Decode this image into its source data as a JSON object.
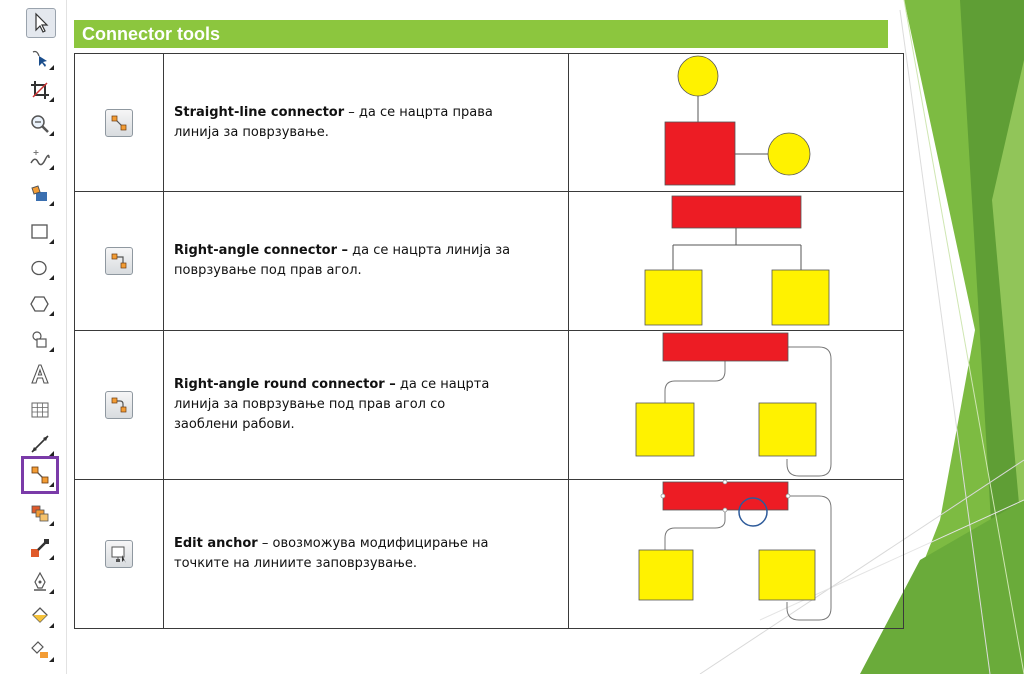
{
  "section_title": "Connector tools",
  "toolbox": {
    "tools": [
      {
        "name": "pick-tool",
        "icon": "arrow-icon"
      },
      {
        "name": "shape-tool",
        "icon": "node-edit-icon"
      },
      {
        "name": "crop-tool",
        "icon": "crop-icon"
      },
      {
        "name": "zoom-tool",
        "icon": "magnifier-icon"
      },
      {
        "name": "freehand-tool",
        "icon": "freehand-icon"
      },
      {
        "name": "smart-fill-tool",
        "icon": "smart-fill-icon"
      },
      {
        "name": "rectangle-tool",
        "icon": "rectangle-icon"
      },
      {
        "name": "ellipse-tool",
        "icon": "ellipse-icon"
      },
      {
        "name": "polygon-tool",
        "icon": "polygon-icon"
      },
      {
        "name": "basic-shapes-tool",
        "icon": "basic-shapes-icon"
      },
      {
        "name": "text-tool",
        "icon": "text-a-icon"
      },
      {
        "name": "table-tool",
        "icon": "table-icon"
      },
      {
        "name": "dimension-tool",
        "icon": "dimension-icon"
      },
      {
        "name": "connector-tool",
        "icon": "connector-icon"
      },
      {
        "name": "blend-tool",
        "icon": "blend-icon"
      },
      {
        "name": "eyedropper-tool",
        "icon": "eyedropper-icon"
      },
      {
        "name": "outline-tool",
        "icon": "pen-nib-icon"
      },
      {
        "name": "fill-tool",
        "icon": "paint-bucket-icon"
      },
      {
        "name": "interactive-fill-tool",
        "icon": "interactive-fill-icon"
      }
    ]
  },
  "rows": [
    {
      "icon": "straight-line-connector-icon",
      "name": "Straight-line connector",
      "sep": " – ",
      "line1_rest": "да се нацрта права",
      "line2": "линија за поврзување."
    },
    {
      "icon": "right-angle-connector-icon",
      "name": "Right-angle connector –",
      "sep": " ",
      "line1_rest": "да се нацрта линија за",
      "line2": "поврзување под прав агол."
    },
    {
      "icon": "right-angle-round-connector-icon",
      "name": "Right-angle round connector –",
      "sep": " ",
      "line1_rest": "да се нацрта",
      "line2": "линија за поврзување под прав агол со",
      "line3": "заоблени рабови."
    },
    {
      "icon": "edit-anchor-icon",
      "name": "Edit anchor",
      "sep": " – ",
      "line1_rest": "овозможува модифицирање  на",
      "line2": "точките на линиите заповрзување."
    }
  ],
  "colors": {
    "header_green": "#8cc63e",
    "shape_red": "#ed1c24",
    "shape_yellow": "#fff200",
    "highlight_purple": "#7a3ba8"
  }
}
